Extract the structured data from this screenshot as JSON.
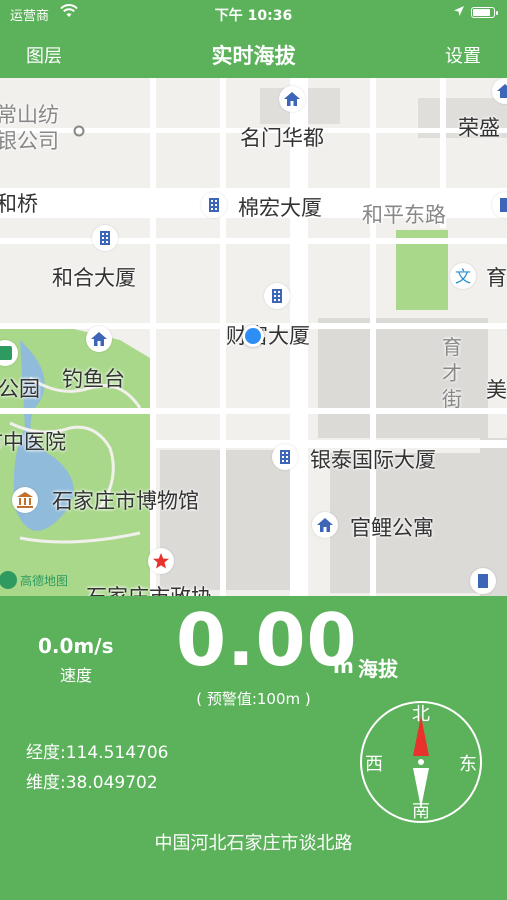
{
  "status_bar": {
    "carrier": "运营商",
    "time": "下午 10:36",
    "battery_level": 0.9
  },
  "nav": {
    "left_label": "图层",
    "title": "实时海拔",
    "right_label": "设置"
  },
  "map": {
    "labels": {
      "mingmen": "名门华都",
      "ronghua": "荣盛",
      "mianhong": "棉宏大厦",
      "heping": "和平东路",
      "hehe": "和合大厦",
      "caifu": "财富大厦",
      "yucai": "育\n才\n街",
      "diaoyutai": "钓鱼台",
      "zhongyi": "市中医院",
      "museum": "石家庄市博物馆",
      "yintai": "银泰国际大厦",
      "guanli": "官鲤公寓",
      "park": "公园",
      "bridge": "和桥",
      "top_left": "常山纺\n银公司",
      "zhengfu": "石家庄市政协",
      "mei": "美",
      "yu": "育"
    },
    "watermark": "高德地图",
    "poi_icons": [
      "house-icon",
      "building-icon",
      "culture-icon",
      "museum-icon",
      "star-icon"
    ]
  },
  "panel": {
    "speed_value": "0.0m/s",
    "speed_label": "速度",
    "altitude_value": "0.00",
    "altitude_unit": "m",
    "altitude_label": "海拔",
    "warning": "( 预警值:100m )",
    "longitude": "经度:114.514706",
    "latitude": "维度:38.049702",
    "address": "中国河北石家庄市谈北路",
    "compass": {
      "north": "北",
      "south": "南",
      "east": "东",
      "west": "西"
    }
  },
  "colors": {
    "brand_green": "#5cb15b",
    "location_blue": "#2d8ff5",
    "poi_blue": "#3d65b8",
    "compass_red": "#e8332c"
  }
}
